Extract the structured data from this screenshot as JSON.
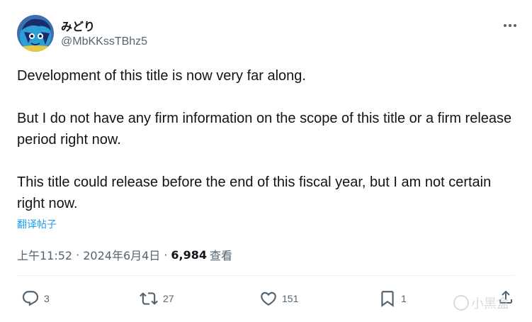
{
  "author": {
    "display_name": "みどり",
    "handle": "@MbKKssTBhz5",
    "avatar_icon": "anime-avatar-icon"
  },
  "tweet": {
    "paragraphs": [
      "Development of this title is now very far along.",
      "But I do not have any firm information on the scope of this title or a firm release period right now.",
      "This title could release before the end of this fiscal year, but I am not certain right now."
    ],
    "translate_label": "翻译帖子",
    "time": "上午11:52",
    "separator": "·",
    "date": "2024年6月4日",
    "views_count": "6,984",
    "views_label": "查看"
  },
  "actions": {
    "reply_count": "3",
    "retweet_count": "27",
    "like_count": "151",
    "bookmark_count": "1"
  },
  "watermark": {
    "text": "小黑盒"
  },
  "colors": {
    "text_primary": "#0f1419",
    "text_secondary": "#536471",
    "link_blue": "#1d9bf0",
    "divider": "#eff3f4"
  }
}
